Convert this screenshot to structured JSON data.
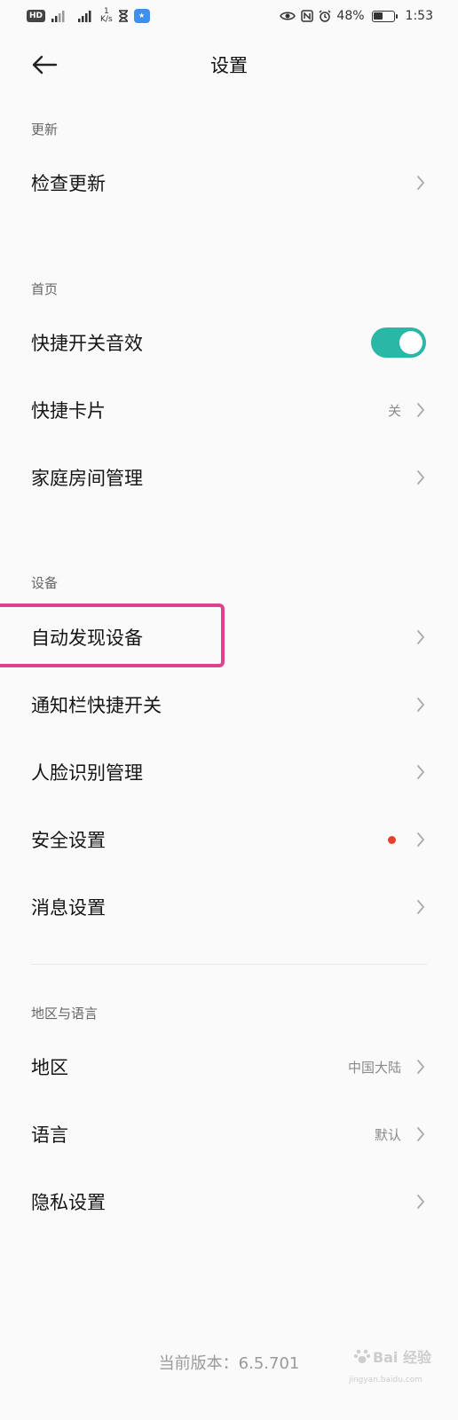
{
  "status_bar": {
    "hd_label": "HD",
    "net_speed_value": "1",
    "net_speed_unit": "K/s",
    "app_badge": "★",
    "battery_percent": "48%",
    "battery_level": 0.48,
    "time": "1:53"
  },
  "header": {
    "title": "设置"
  },
  "sections": {
    "update": {
      "title": "更新"
    },
    "home": {
      "title": "首页"
    },
    "device": {
      "title": "设备"
    },
    "region_lang": {
      "title": "地区与语言"
    }
  },
  "rows": {
    "check_update": {
      "label": "检查更新"
    },
    "quick_switch_sound": {
      "label": "快捷开关音效",
      "toggle_on": true
    },
    "quick_card": {
      "label": "快捷卡片",
      "value": "关"
    },
    "home_room_manage": {
      "label": "家庭房间管理"
    },
    "auto_discover": {
      "label": "自动发现设备"
    },
    "notif_quick_switch": {
      "label": "通知栏快捷开关"
    },
    "face_recognition": {
      "label": "人脸识别管理"
    },
    "security": {
      "label": "安全设置",
      "has_badge": true
    },
    "message": {
      "label": "消息设置"
    },
    "region": {
      "label": "地区",
      "value": "中国大陆"
    },
    "language": {
      "label": "语言",
      "value": "默认"
    },
    "privacy": {
      "label": "隐私设置"
    }
  },
  "footer": {
    "version": "当前版本：6.5.701",
    "watermark": "Bai 经验",
    "watermark_url": "jingyan.baidu.com"
  },
  "colors": {
    "accent_toggle": "#2ab7a6",
    "highlight": "#e0418e",
    "badge_red": "#e8402e"
  }
}
